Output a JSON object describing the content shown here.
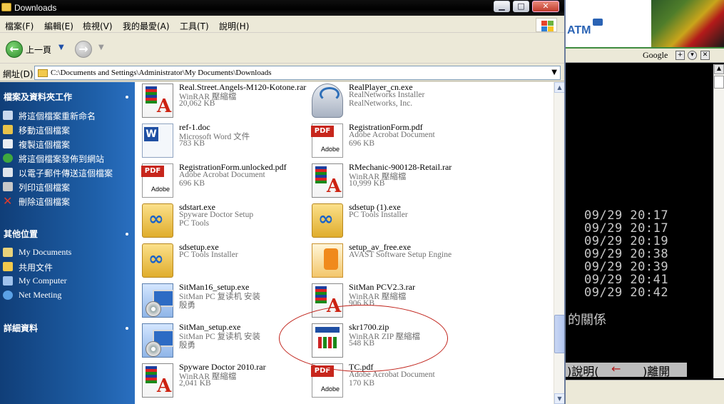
{
  "window": {
    "title": "Downloads"
  },
  "menubar": [
    "檔案(F)",
    "編輯(E)",
    "檢視(V)",
    "我的最愛(A)",
    "工具(T)",
    "說明(H)"
  ],
  "toolbar": {
    "back_label": "上一頁"
  },
  "address": {
    "label": "網址(D)",
    "path": "C:\\Documents and Settings\\Administrator\\My Documents\\Downloads"
  },
  "taskpane": {
    "tasks_title": "檔案及資料夾工作",
    "tasks": [
      "將這個檔案重新命名",
      "移動這個檔案",
      "複製這個檔案",
      "將這個檔案發佈到網站",
      "以電子郵件傳送這個檔案",
      "列印這個檔案",
      "刪除這個檔案"
    ],
    "places_title": "其他位置",
    "places": [
      "My Documents",
      "共用文件",
      "My Computer",
      "Net Meeting"
    ],
    "details_title": "詳細資料"
  },
  "files": [
    {
      "name": "Real.Street.Angels-M120-Kotone.rar",
      "type": "WinRAR 壓縮檔",
      "size": "20,062 KB",
      "icon": "rar-icon"
    },
    {
      "name": "RealPlayer_cn.exe",
      "type": "RealNetworks Installer",
      "size": "RealNetworks, Inc.",
      "icon": "realplayer-icon"
    },
    {
      "name": "ref-1.doc",
      "type": "Microsoft Word 文件",
      "size": "783 KB",
      "icon": "word-icon"
    },
    {
      "name": "RegistrationForm.pdf",
      "type": "Adobe Acrobat Document",
      "size": "696 KB",
      "icon": "pdf-icon"
    },
    {
      "name": "RegistrationForm.unlocked.pdf",
      "type": "Adobe Acrobat Document",
      "size": "696 KB",
      "icon": "pdf-icon"
    },
    {
      "name": "RMechanic-900128-Retail.rar",
      "type": "WinRAR 壓縮檔",
      "size": "10,999 KB",
      "icon": "rar-icon"
    },
    {
      "name": "sdstart.exe",
      "type": "Spyware Doctor Setup",
      "size": "PC Tools",
      "icon": "pctools-icon"
    },
    {
      "name": "sdsetup (1).exe",
      "type": "PC Tools Installer",
      "size": "",
      "icon": "pctools-icon"
    },
    {
      "name": "sdsetup.exe",
      "type": "PC Tools Installer",
      "size": "",
      "icon": "pctools-icon"
    },
    {
      "name": "setup_av_free.exe",
      "type": "AVAST Software Setup Engine",
      "size": "",
      "icon": "avast-icon"
    },
    {
      "name": "SitMan16_setup.exe",
      "type": "SitMan PC 复读机 安装",
      "size": "殷勇",
      "icon": "setup-exe-icon"
    },
    {
      "name": "SitMan PCV2.3.rar",
      "type": "WinRAR 壓縮檔",
      "size": "906 KB",
      "icon": "rar-icon"
    },
    {
      "name": "SitMan_setup.exe",
      "type": "SitMan PC 复读机 安装",
      "size": "殷勇",
      "icon": "setup-exe-icon"
    },
    {
      "name": "skr1700.zip",
      "type": "WinRAR ZIP 壓縮檔",
      "size": "548 KB",
      "icon": "zip-icon"
    },
    {
      "name": "Spyware Doctor 2010.rar",
      "type": "WinRAR 壓縮檔",
      "size": "2,041 KB",
      "icon": "rar-icon"
    },
    {
      "name": "TC.pdf",
      "type": "Adobe Acrobat Document",
      "size": "170 KB",
      "icon": "pdf-icon"
    }
  ],
  "background_window": {
    "banner_text": "ATM",
    "toolbar_label": "Google",
    "timestamps": [
      "09/29 20:17",
      "09/29 20:17",
      "09/29 20:19",
      "09/29 20:38",
      "09/29 20:39",
      "09/29 20:41",
      "09/29 20:42"
    ],
    "text_line": "的關係",
    "help_bar": {
      "part1": ")說明(",
      "arrow": "←",
      "part2": ")離開"
    }
  },
  "colors": {
    "taskpane_bg": "#1e5fa8",
    "annotation": "#c0221a"
  }
}
